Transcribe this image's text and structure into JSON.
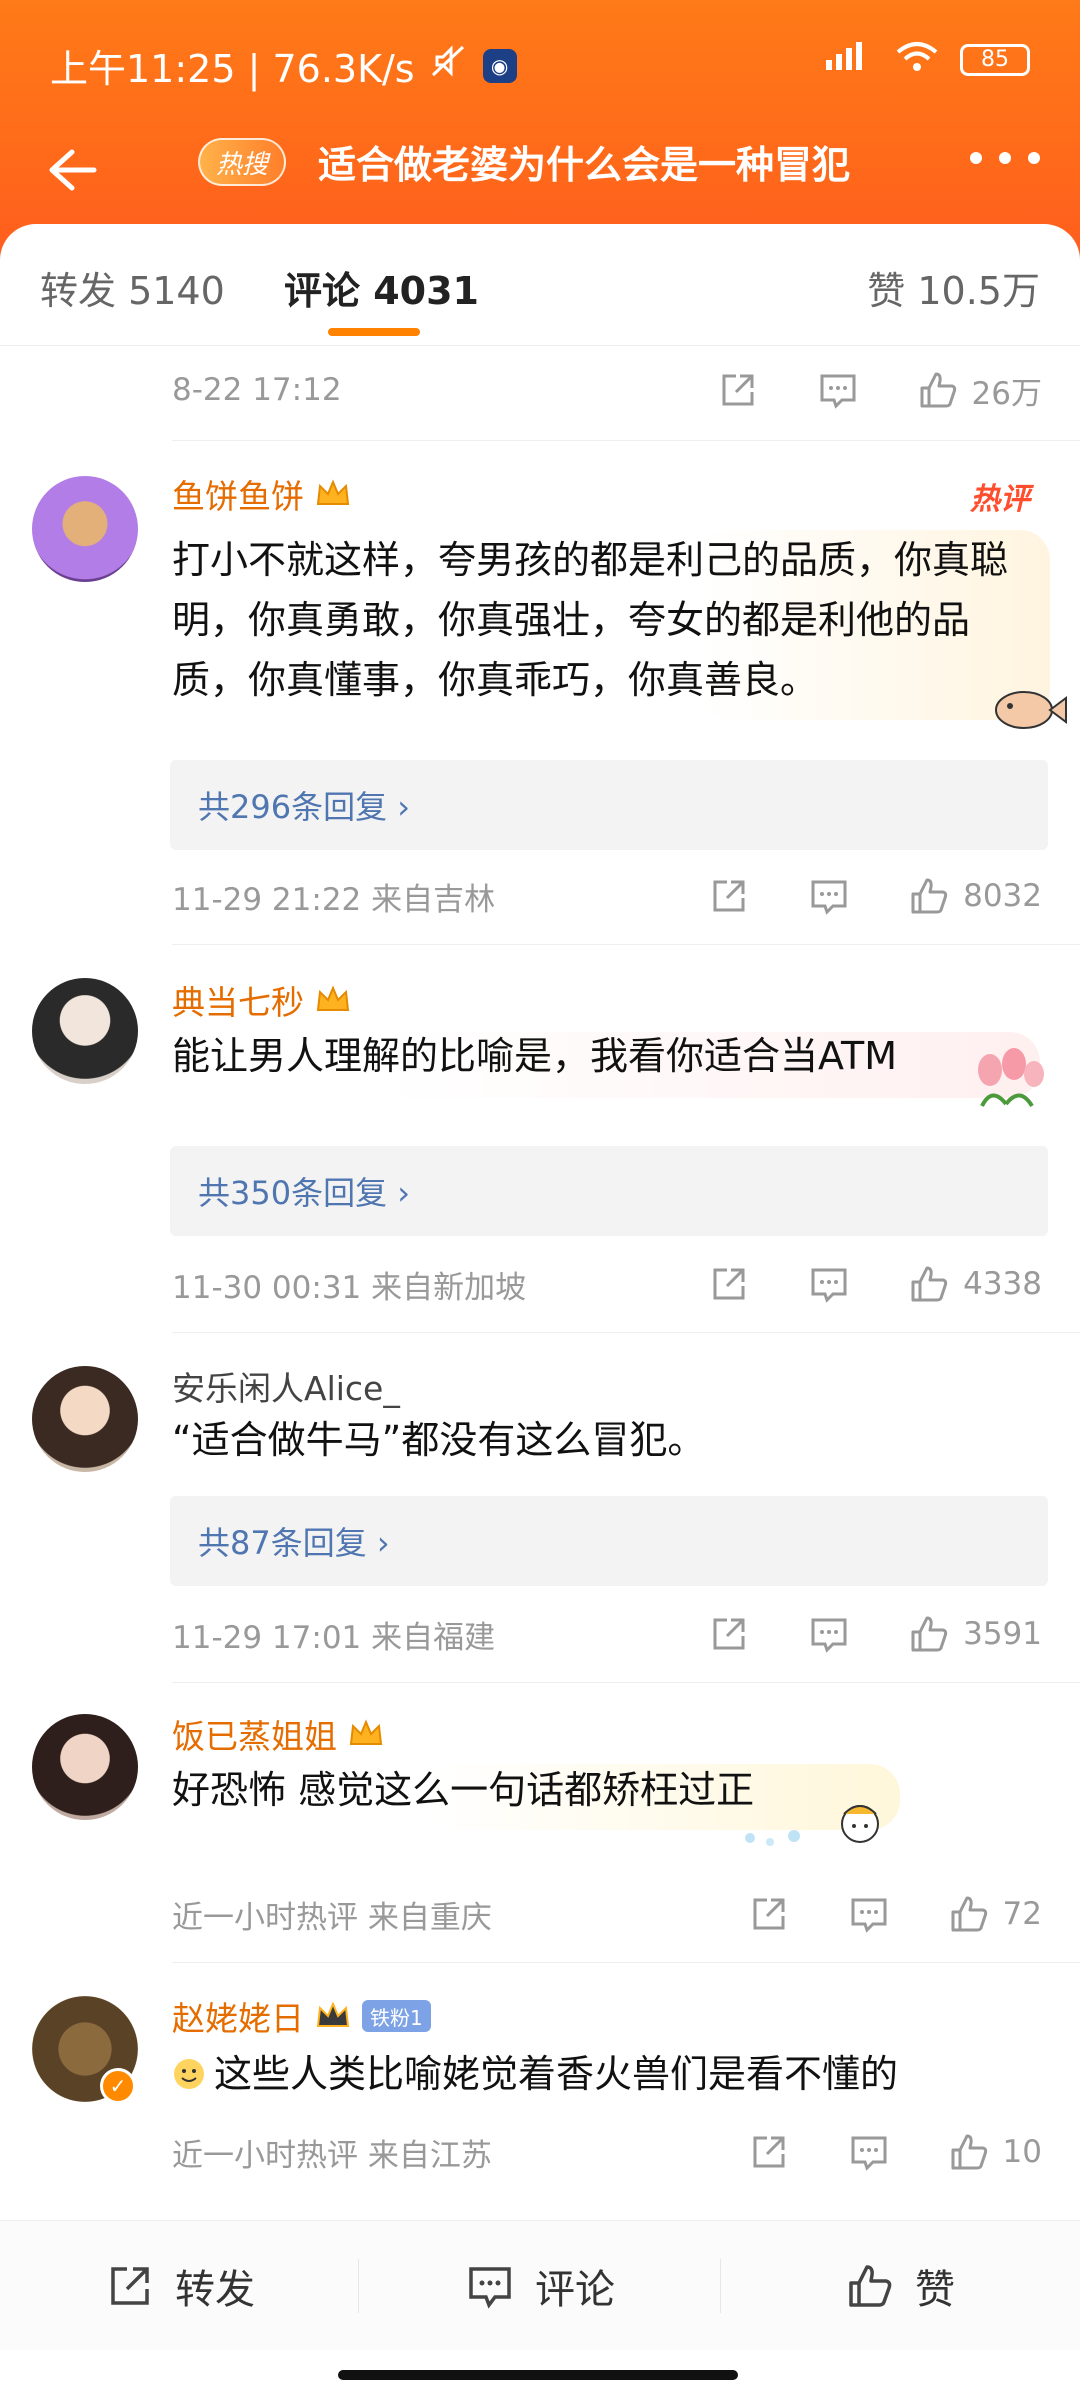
{
  "status": {
    "time_speed": "上午11:25 | 76.3K/s",
    "battery": "85"
  },
  "header": {
    "hot_label": "热搜",
    "title": "适合做老婆为什么会是一种冒犯"
  },
  "tabs": {
    "repost": "转发 5140",
    "comments": "评论 4031",
    "likes": "赞 10.5万"
  },
  "post_meta": {
    "time": "8-22 17:12",
    "likes": "26万"
  },
  "comments": [
    {
      "username": "鱼饼鱼饼",
      "hot_tag": "热评",
      "text": "打小不就这样，夸男孩的都是利己的品质，你真聪明，你真勇敢，你真强壮，夸女的都是利他的品质，你真懂事，你真乖巧，你真善良。",
      "replies": "共296条回复 ›",
      "meta": "11-29 21:22  来自吉林",
      "likes": "8032"
    },
    {
      "username": "典当七秒",
      "text": "能让男人理解的比喻是，我看你适合当ATM",
      "replies": "共350条回复 ›",
      "meta": "11-30 00:31  来自新加坡",
      "likes": "4338"
    },
    {
      "username": "安乐闲人Alice_",
      "text": "“适合做牛马”都没有这么冒犯。",
      "replies": "共87条回复 ›",
      "meta": "11-29 17:01  来自福建",
      "likes": "3591"
    },
    {
      "username": "饭已蒸姐姐",
      "text": "好恐怖 感觉这么一句话都矫枉过正",
      "meta": "近一小时热评  来自重庆",
      "likes": "72"
    },
    {
      "username": "赵姥姥日",
      "fan_badge": "铁粉1",
      "text": "这些人类比喻姥觉着香火兽们是看不懂的",
      "meta": "近一小时热评  来自江苏",
      "likes": "10"
    }
  ],
  "bottom_bar": {
    "repost": "转发",
    "comment": "评论",
    "like": "赞"
  },
  "colors": {
    "header": "#ff6a1a",
    "accent": "#ff8200",
    "username": "#e56d00",
    "reply_link": "#4f76b0"
  }
}
